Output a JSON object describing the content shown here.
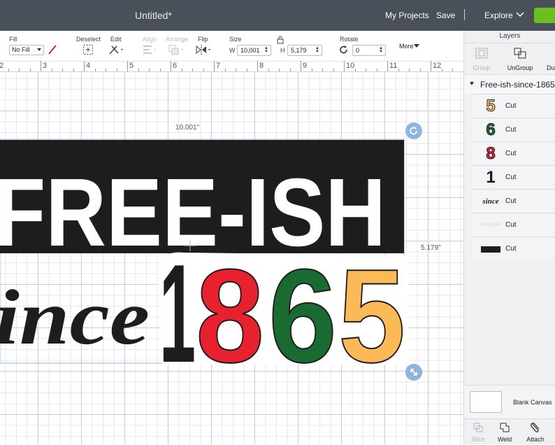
{
  "header": {
    "title": "Untitled*",
    "my_projects": "My Projects",
    "save": "Save",
    "explore": "Explore"
  },
  "toolbar": {
    "fill_label": "Fill",
    "fill_value": "No Fill",
    "deselect_label": "Deselect",
    "edit_label": "Edit",
    "align_label": "Align",
    "arrange_label": "Arrange",
    "flip_label": "Flip",
    "size_label": "Size",
    "w_label": "W",
    "w_value": "10,001",
    "h_label": "H",
    "h_value": "5,179",
    "rotate_label": "Rotate",
    "rotate_value": "0",
    "more_label": "More"
  },
  "ruler": {
    "ticks": [
      "2",
      "3",
      "4",
      "5",
      "6",
      "7",
      "8",
      "9",
      "10",
      "11",
      "12"
    ]
  },
  "canvas": {
    "width_dim": "10.001\"",
    "height_dim": "5.179\"",
    "design_line1": "FREE-ISH",
    "design_line2": "ince",
    "digits": [
      "1",
      "8",
      "6",
      "5"
    ],
    "colors": {
      "black": "#1f1c1d",
      "red": "#e8212e",
      "green": "#1a6b31",
      "orange": "#fbb957",
      "selection": "#8fb4dd"
    }
  },
  "layers": {
    "title": "Layers",
    "group_label": "Group",
    "ungroup_label": "UnGroup",
    "dup_label": "Du",
    "group_name": "Free-ish-since-1865",
    "items": [
      {
        "thumb": "5",
        "label": "Cut"
      },
      {
        "thumb": "6",
        "label": "Cut"
      },
      {
        "thumb": "8",
        "label": "Cut"
      },
      {
        "thumb": "1",
        "label": "Cut"
      },
      {
        "thumb": "since",
        "label": "Cut"
      },
      {
        "thumb": "FREE-ISH",
        "label": "Cut"
      },
      {
        "thumb": "",
        "label": "Cut"
      }
    ],
    "blank_canvas": "Blank Canvas",
    "slice_label": "Slice",
    "weld_label": "Weld",
    "attach_label": "Attach"
  }
}
